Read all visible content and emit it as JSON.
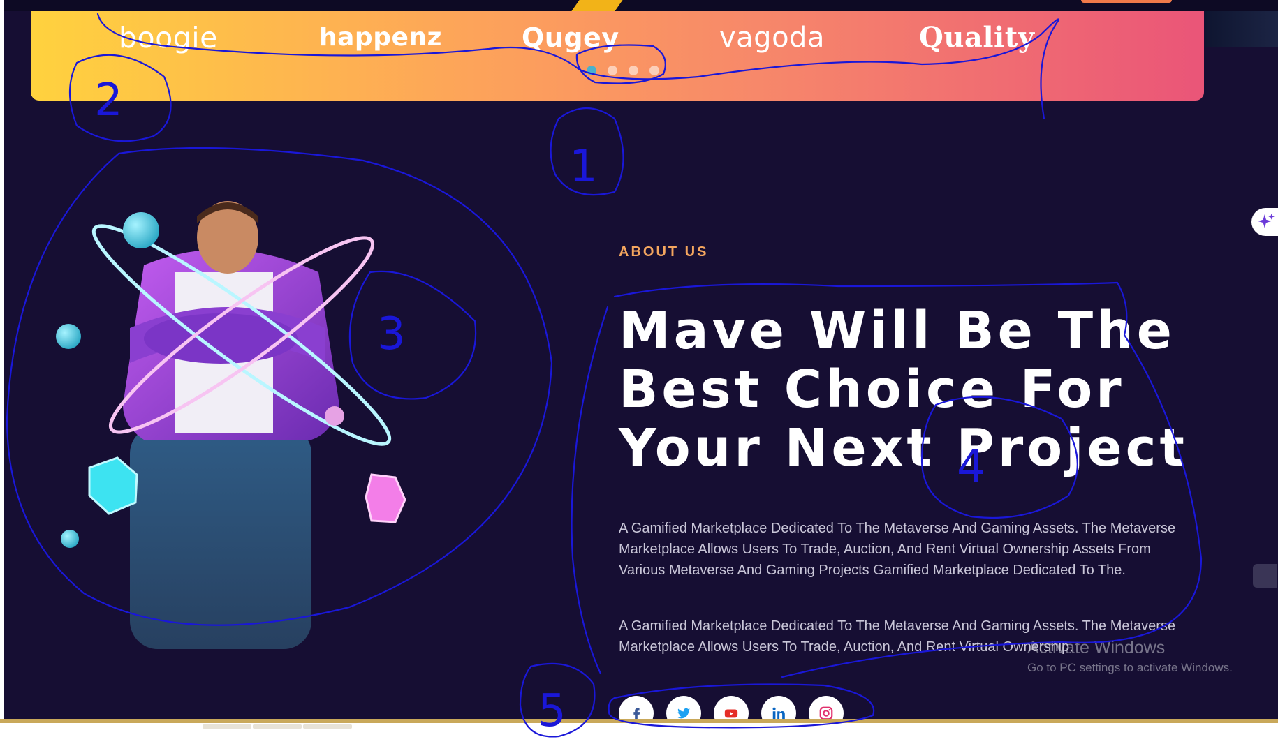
{
  "brands": [
    "boogie",
    "happenz",
    "Qugey",
    "vagoda",
    "Quality"
  ],
  "slider": {
    "dot_count": 4,
    "active_index": 0
  },
  "about": {
    "eyebrow": "ABOUT US",
    "headline": "Mave Will Be The Best Choice For Your Next Project",
    "paragraph1": "A Gamified Marketplace Dedicated To The Metaverse And Gaming Assets. The Metaverse Marketplace Allows Users To Trade, Auction, And Rent Virtual Ownership Assets From Various Metaverse And Gaming Projects Gamified Marketplace Dedicated To The.",
    "paragraph2": "A Gamified Marketplace Dedicated To The Metaverse And Gaming Assets. The Metaverse Marketplace Allows Users To Trade, Auction, And Rent Virtual Ownership."
  },
  "socials": [
    {
      "icon": "facebook-icon",
      "color": "#3b5998"
    },
    {
      "icon": "twitter-icon",
      "color": "#1da1f2"
    },
    {
      "icon": "youtube-icon",
      "color": "#e52d27"
    },
    {
      "icon": "linkedin-icon",
      "color": "#0a66c2"
    },
    {
      "icon": "instagram-icon",
      "color": "#e1306c"
    }
  ],
  "watermark": {
    "title": "Activate Windows",
    "subtitle": "Go to PC settings to activate Windows."
  },
  "annotation_labels": [
    "1",
    "2",
    "3",
    "4",
    "5"
  ],
  "colors": {
    "page_bg": "#160e33",
    "accent_orange": "#f4a65f",
    "gradient_start": "#ffd23e",
    "gradient_end": "#ea5578",
    "annotation_ink": "#1a17d8"
  }
}
